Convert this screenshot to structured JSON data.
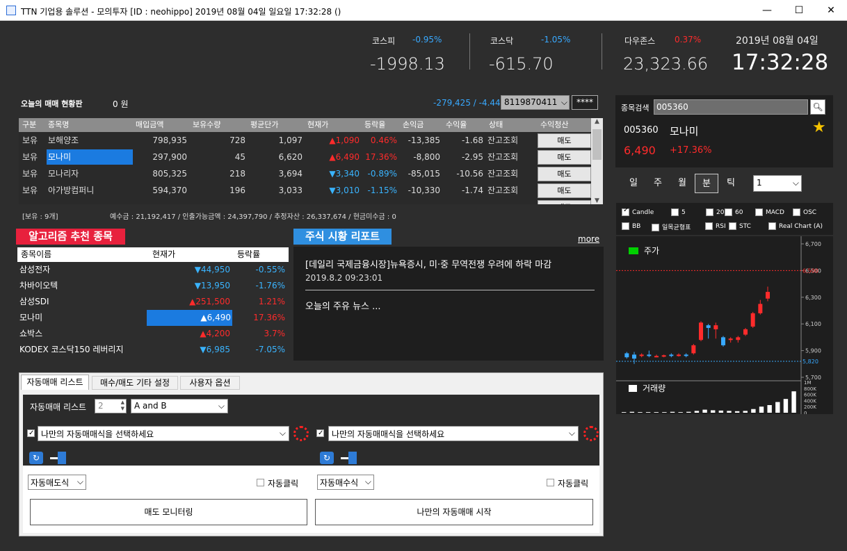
{
  "window": {
    "title": "TTN 기업용 솔루션 - 모의투자 [ID : neohippo] 2019년 08월 04일 일요일 17:32:28 ()",
    "min": "—",
    "max": "☐",
    "close": "✕"
  },
  "indices": [
    {
      "label": "코스피",
      "change": "-0.95%",
      "value": "-1998.13",
      "color": "#38a9ff"
    },
    {
      "label": "코스닥",
      "change": "-1.05%",
      "value": "-615.70",
      "color": "#38a9ff"
    },
    {
      "label": "다우존스",
      "change": "0.37%",
      "value": "23,323.66",
      "color": "#ff2b2b"
    }
  ],
  "clock": {
    "date": "2019년 08월 04일",
    "time": "17:32:28"
  },
  "board": {
    "title": "오늘의 매매 현황판",
    "amount": "0 원",
    "pnl": "-279,425 / -4.44",
    "account": "8119870411",
    "password": "****",
    "headers": [
      "구분",
      "종목명",
      "매입금액",
      "보유수량",
      "평균단가",
      "현재가",
      "등락율",
      "손익금",
      "수익율",
      "상태",
      "수익청산"
    ],
    "rows": [
      {
        "type": "보유",
        "name": "보해양조",
        "buy": "798,935",
        "qty": "728",
        "avg": "1,097",
        "price": "▲1,090",
        "rate": "0.46%",
        "pl": "-13,385",
        "ret": "-1.68",
        "status": "잔고조회",
        "action": "매도",
        "pc": "up",
        "rc": "up",
        "selected": false
      },
      {
        "type": "보유",
        "name": "모나미",
        "buy": "297,900",
        "qty": "45",
        "avg": "6,620",
        "price": "▲6,490",
        "rate": "17.36%",
        "pl": "-8,800",
        "ret": "-2.95",
        "status": "잔고조회",
        "action": "매도",
        "pc": "up",
        "rc": "up",
        "selected": true
      },
      {
        "type": "보유",
        "name": "모나리자",
        "buy": "805,325",
        "qty": "218",
        "avg": "3,694",
        "price": "▼3,340",
        "rate": "-0.89%",
        "pl": "-85,015",
        "ret": "-10.56",
        "status": "잔고조회",
        "action": "매도",
        "pc": "dn",
        "rc": "dn",
        "selected": false
      },
      {
        "type": "보유",
        "name": "아가방컴퍼니",
        "buy": "594,370",
        "qty": "196",
        "avg": "3,033",
        "price": "▼3,010",
        "rate": "-1.15%",
        "pl": "-10,330",
        "ret": "-1.74",
        "status": "잔고조회",
        "action": "매도",
        "pc": "dn",
        "rc": "dn",
        "selected": false
      }
    ],
    "partial_action": "매도",
    "summary_left": "[보유 : 9개]",
    "summary": "예수금 : 21,192,417 / 인출가능금액 : 24,397,790 / 추정자산 : 26,337,674 / 현금미수금 : 0"
  },
  "algo": {
    "title": "알고리즘 추천 종목",
    "headers": [
      "종목이름",
      "현재가",
      "등락률"
    ],
    "rows": [
      {
        "name": "삼성전자",
        "price": "▼44,950",
        "rate": "-0.55%",
        "c": "dn",
        "selected": false
      },
      {
        "name": "차바이오텍",
        "price": "▼13,950",
        "rate": "-1.76%",
        "c": "dn",
        "selected": false
      },
      {
        "name": "삼성SDI",
        "price": "▲251,500",
        "rate": "1.21%",
        "c": "up",
        "selected": false
      },
      {
        "name": "모나미",
        "price": "▲6,490",
        "rate": "17.36%",
        "c": "up",
        "selected": true
      },
      {
        "name": "쇼박스",
        "price": "▲4,200",
        "rate": "3.7%",
        "c": "up",
        "selected": false
      },
      {
        "name": "KODEX 코스닥150 레버리지",
        "price": "▼6,985",
        "rate": "-7.05%",
        "c": "dn",
        "selected": false
      }
    ]
  },
  "report": {
    "title": "주식 시황 리포트",
    "more": "more",
    "headline": "[데일리 국제금융시장]뉴욕증시, 미·중 무역전쟁 우려에 하락 마감",
    "time": "2019.8.2 09:23:01",
    "news": "오늘의 주유 뉴스 ..."
  },
  "tabs": [
    "자동매매 리스트",
    "매수/매도 기타 설정",
    "사용자 옵션"
  ],
  "auto": {
    "list_label": "자동매매 리스트",
    "count": "2",
    "combine": "A and B",
    "left": {
      "strategy": "나만의 자동매매식을 선택하세요",
      "mode": "자동매도식",
      "click": "자동클릭",
      "button": "매도 모니터링"
    },
    "right": {
      "strategy": "나만의 자동매매식을 선택하세요",
      "mode": "자동매수식",
      "click": "자동클릭",
      "button": "나만의 자동매매 시작"
    }
  },
  "stock": {
    "search_label": "종목검색",
    "code_input": "005360",
    "code": "005360",
    "name": "모나미",
    "price": "6,490",
    "change": "+17.36%",
    "periods": [
      "일",
      "주",
      "월",
      "분",
      "틱"
    ],
    "active_period": "분",
    "interval": "1",
    "indicators": [
      {
        "label": "Candle",
        "on": true
      },
      {
        "label": "5",
        "on": false
      },
      {
        "label": "20",
        "on": false
      },
      {
        "label": "60",
        "on": false
      },
      {
        "label": "MACD",
        "on": false
      },
      {
        "label": "OSC",
        "on": false
      },
      {
        "label": "BB",
        "on": false
      },
      {
        "label": "일목균형표",
        "on": false
      },
      {
        "label": "RSI",
        "on": false
      },
      {
        "label": "STC",
        "on": false
      },
      {
        "label": "Real Chart (A)",
        "on": false
      }
    ]
  },
  "chart_data": {
    "type": "candlestick",
    "legend": "주가",
    "volume_legend": "거래량",
    "y_ticks": [
      "6,700",
      "6,500",
      "6,300",
      "6,100",
      "5,900",
      "5,700"
    ],
    "ylim": [
      5700,
      6700
    ],
    "reference_lines": [
      {
        "value": "6,500",
        "color": "#ff2b2b"
      },
      {
        "value": "5,820",
        "color": "#38a9ff"
      }
    ],
    "volume_ticks": [
      "1M",
      "800K",
      "600K",
      "400K",
      "200K",
      "0"
    ],
    "candles": [
      {
        "o": 5880,
        "c": 5850,
        "h": 5890,
        "l": 5840
      },
      {
        "o": 5870,
        "c": 5840,
        "h": 5890,
        "l": 5800
      },
      {
        "o": 5860,
        "c": 5870,
        "h": 5880,
        "l": 5850
      },
      {
        "o": 5870,
        "c": 5860,
        "h": 5900,
        "l": 5850
      },
      {
        "o": 5860,
        "c": 5860,
        "h": 5870,
        "l": 5850
      },
      {
        "o": 5860,
        "c": 5865,
        "h": 5870,
        "l": 5850
      },
      {
        "o": 5870,
        "c": 5860,
        "h": 5880,
        "l": 5850
      },
      {
        "o": 5860,
        "c": 5870,
        "h": 5880,
        "l": 5855
      },
      {
        "o": 5870,
        "c": 5860,
        "h": 5880,
        "l": 5850
      },
      {
        "o": 5880,
        "c": 5940,
        "h": 5950,
        "l": 5870
      },
      {
        "o": 5980,
        "c": 6110,
        "h": 6120,
        "l": 5970
      },
      {
        "o": 6090,
        "c": 6070,
        "h": 6100,
        "l": 5990
      },
      {
        "o": 6060,
        "c": 6090,
        "h": 6110,
        "l": 5990
      },
      {
        "o": 6000,
        "c": 5940,
        "h": 6010,
        "l": 5930
      },
      {
        "o": 5980,
        "c": 5990,
        "h": 6000,
        "l": 5960
      },
      {
        "o": 5980,
        "c": 6000,
        "h": 6010,
        "l": 5960
      },
      {
        "o": 6020,
        "c": 6060,
        "h": 6070,
        "l": 6010
      },
      {
        "o": 6080,
        "c": 6180,
        "h": 6190,
        "l": 6070
      },
      {
        "o": 6180,
        "c": 6250,
        "h": 6280,
        "l": 6170
      },
      {
        "o": 6290,
        "c": 6340,
        "h": 6380,
        "l": 6270
      }
    ],
    "volumes": [
      0.02,
      0.03,
      0.02,
      0.02,
      0.02,
      0.02,
      0.03,
      0.02,
      0.03,
      0.06,
      0.1,
      0.08,
      0.07,
      0.06,
      0.05,
      0.06,
      0.12,
      0.2,
      0.25,
      0.35,
      0.45,
      0.7
    ]
  }
}
